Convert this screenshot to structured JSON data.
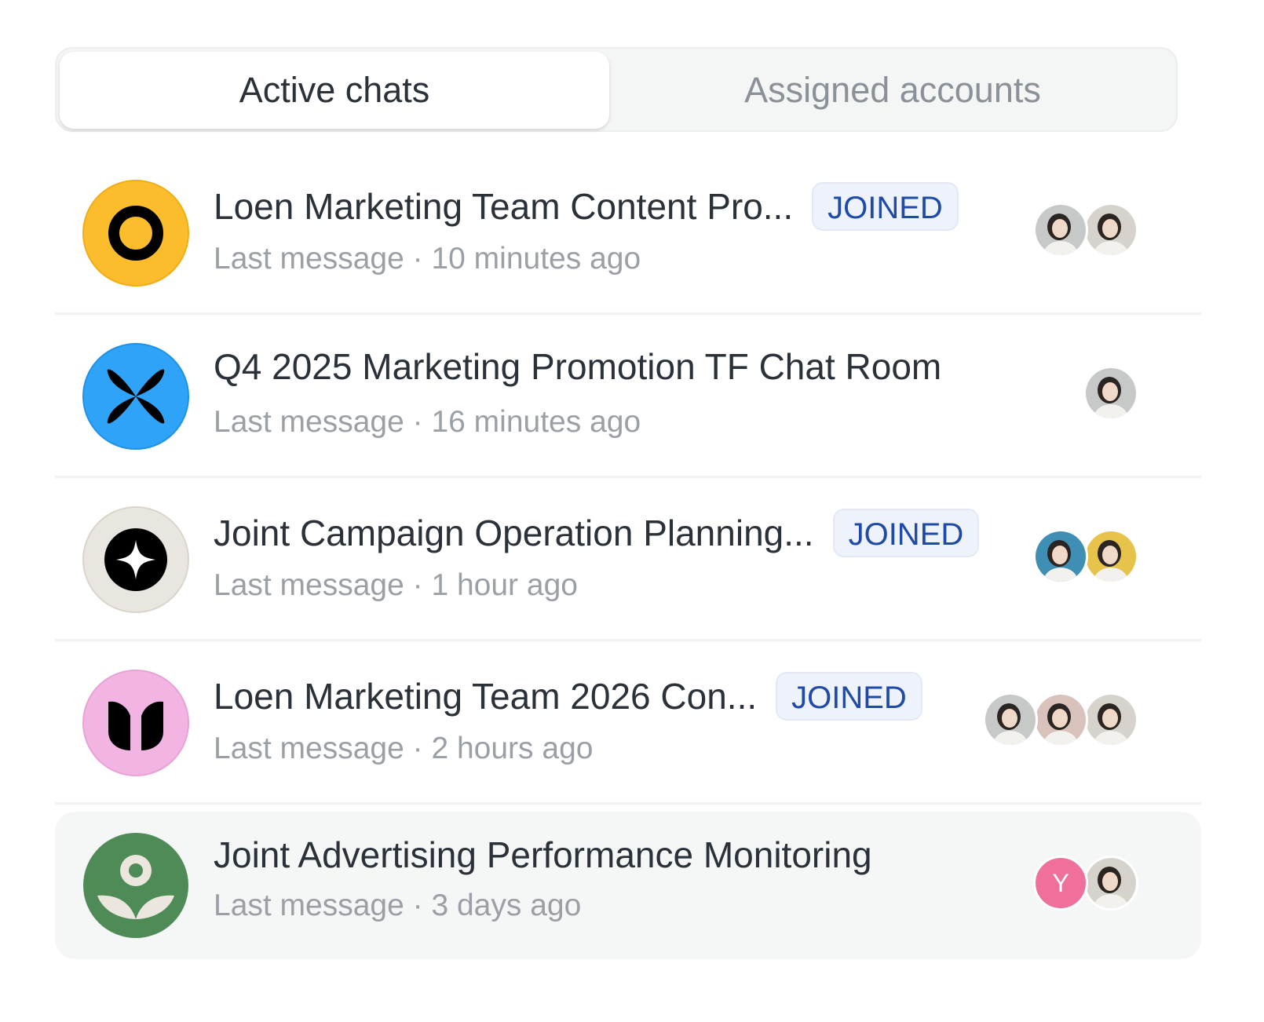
{
  "tabs": [
    {
      "label": "Active chats",
      "active": true
    },
    {
      "label": "Assigned accounts",
      "active": false
    }
  ],
  "chats": [
    {
      "title": "Loen Marketing Team Content Pro...",
      "badge": "JOINED",
      "last_message": "Last message · 10 minutes ago",
      "logo": {
        "icon": "ring-logo-icon",
        "bg": "#fbbd2c",
        "fg": "#000000"
      },
      "avatars": [
        {
          "type": "photo",
          "tone": "#c7c9c9"
        },
        {
          "type": "photo",
          "tone": "#d6d3cc"
        }
      ]
    },
    {
      "title": "Q4 2025 Marketing Promotion TF Chat Room",
      "badge": "",
      "last_message": "Last message · 16 minutes ago",
      "logo": {
        "icon": "butterfly-logo-icon",
        "bg": "#2ea3f7",
        "fg": "#000000"
      },
      "avatars": [
        {
          "type": "photo",
          "tone": "#c7c9c9"
        }
      ]
    },
    {
      "title": "Joint Campaign Operation Planning...",
      "badge": "JOINED",
      "last_message": "Last message · 1 hour ago",
      "logo": {
        "icon": "sparkle-logo-icon",
        "bg": "#e9e6df",
        "fg": "#000000"
      },
      "avatars": [
        {
          "type": "photo",
          "tone": "#3e8fb3"
        },
        {
          "type": "photo",
          "tone": "#e6c34a"
        }
      ]
    },
    {
      "title": "Loen Marketing Team 2026 Con...",
      "badge": "JOINED",
      "last_message": "Last message · 2 hours ago",
      "logo": {
        "icon": "tulip-logo-icon",
        "bg": "#f2b4e2",
        "fg": "#000000"
      },
      "avatars": [
        {
          "type": "photo",
          "tone": "#c7c9c9"
        },
        {
          "type": "photo",
          "tone": "#d9c2bb"
        },
        {
          "type": "photo",
          "tone": "#d6d3cc"
        }
      ]
    },
    {
      "title": "Joint Advertising Performance Monitoring",
      "badge": "",
      "last_message": "Last message · 3 days ago",
      "logo": {
        "icon": "sprout-logo-icon",
        "bg": "#4f8b57",
        "fg": "#ebe7de"
      },
      "avatars": [
        {
          "type": "initial",
          "text": "Y",
          "bg": "#f0709c"
        },
        {
          "type": "photo",
          "tone": "#d6d3cc"
        }
      ]
    }
  ]
}
